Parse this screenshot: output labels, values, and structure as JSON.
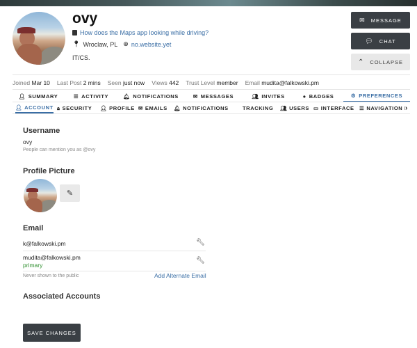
{
  "user": {
    "username": "ovy",
    "title_link": "How does the Maps app looking while driving?",
    "location": "Wroclaw, PL",
    "website": "no.website.yet",
    "bio": "IT/CS."
  },
  "actions": {
    "message": "MESSAGE",
    "chat": "CHAT",
    "collapse": "COLLAPSE"
  },
  "stats": [
    {
      "label": "Joined",
      "value": "Mar 10"
    },
    {
      "label": "Last Post",
      "value": "2 mins"
    },
    {
      "label": "Seen",
      "value": "just now"
    },
    {
      "label": "Views",
      "value": "442"
    },
    {
      "label": "Trust Level",
      "value": "member"
    },
    {
      "label": "Email",
      "value": "mudita@falkowski.pm"
    }
  ],
  "main_nav": [
    {
      "label": "SUMMARY",
      "icon": "user-icon"
    },
    {
      "label": "ACTIVITY",
      "icon": "list-icon"
    },
    {
      "label": "NOTIFICATIONS",
      "icon": "bell-icon"
    },
    {
      "label": "MESSAGES",
      "icon": "envelope-icon"
    },
    {
      "label": "INVITES",
      "icon": "user-plus-icon"
    },
    {
      "label": "BADGES",
      "icon": "badge-icon"
    },
    {
      "label": "PREFERENCES",
      "icon": "gear-icon"
    }
  ],
  "sub_nav": [
    {
      "label": "ACCOUNT",
      "icon": "user-icon"
    },
    {
      "label": "SECURITY",
      "icon": "lock-icon"
    },
    {
      "label": "PROFILE",
      "icon": "user-icon"
    },
    {
      "label": "EMAILS",
      "icon": "envelope-icon"
    },
    {
      "label": "NOTIFICATIONS",
      "icon": "bell-icon"
    },
    {
      "label": "TRACKING",
      "icon": ""
    },
    {
      "label": "USERS",
      "icon": "users-icon"
    },
    {
      "label": "INTERFACE",
      "icon": "desktop-icon"
    },
    {
      "label": "NAVIGATION M",
      "icon": "bars-icon"
    }
  ],
  "account": {
    "username_title": "Username",
    "username_value": "ovy",
    "username_hint": "People can mention you as @ovy",
    "picture_title": "Profile Picture",
    "email_title": "Email",
    "emails": [
      {
        "address": "k@falkowski.pm",
        "primary": ""
      },
      {
        "address": "mudita@falkowski.pm",
        "primary": "primary"
      }
    ],
    "email_hint": "Never shown to the public",
    "add_alternate": "Add Alternate Email",
    "associated_title": "Associated Accounts",
    "save": "SAVE CHANGES"
  },
  "colors": {
    "accent": "#3a6ea5",
    "primary_green": "#2f8f2f",
    "dark_button": "#3a3f44"
  }
}
